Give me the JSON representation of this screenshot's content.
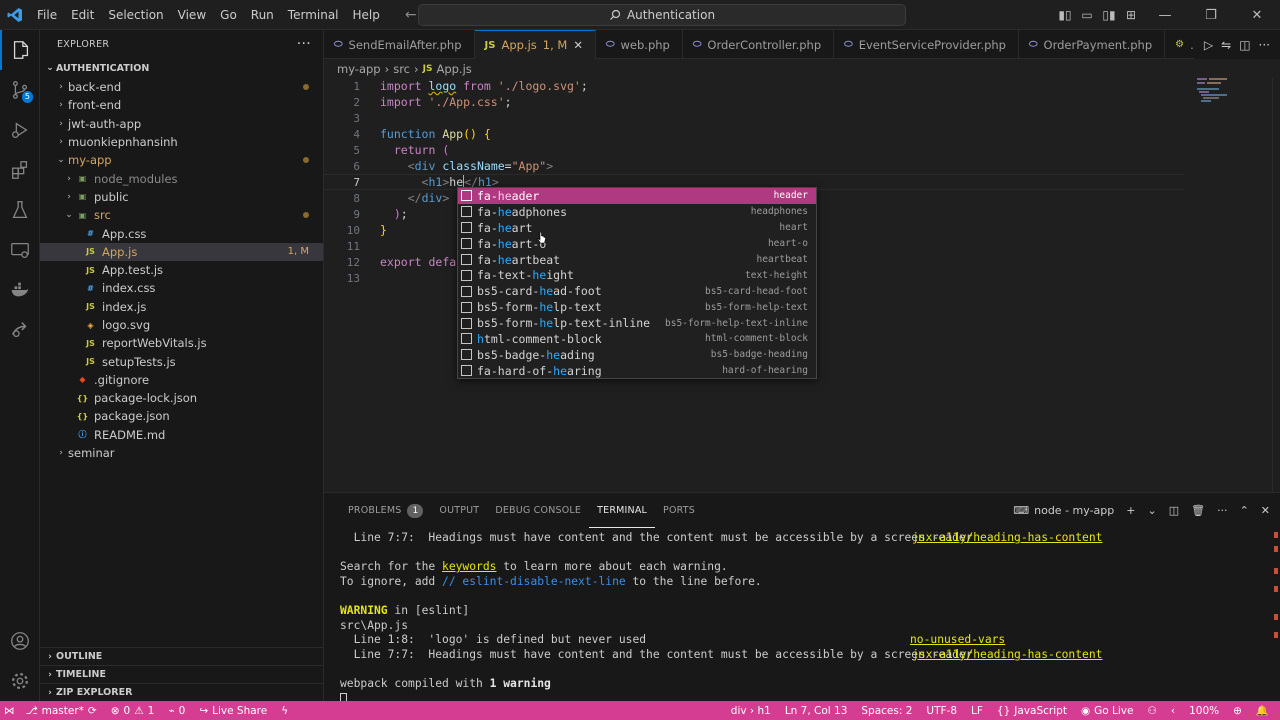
{
  "menubar": {
    "items": [
      "File",
      "Edit",
      "Selection",
      "View",
      "Go",
      "Run",
      "Terminal",
      "Help"
    ]
  },
  "search": {
    "text": "Authentication"
  },
  "sidebar": {
    "header": "EXPLORER",
    "project": "AUTHENTICATION",
    "tree": [
      {
        "label": "back-end",
        "depth": 0,
        "type": "folder",
        "open": false,
        "dot": true
      },
      {
        "label": "front-end",
        "depth": 0,
        "type": "folder",
        "open": false
      },
      {
        "label": "jwt-auth-app",
        "depth": 0,
        "type": "folder",
        "open": false
      },
      {
        "label": "muonkiepnhansinh",
        "depth": 0,
        "type": "folder",
        "open": false
      },
      {
        "label": "my-app",
        "depth": 0,
        "type": "folder",
        "open": true,
        "modified": true,
        "dot": true
      },
      {
        "label": "node_modules",
        "depth": 1,
        "type": "folder-special",
        "open": false,
        "dim": true
      },
      {
        "label": "public",
        "depth": 1,
        "type": "folder-special",
        "open": false
      },
      {
        "label": "src",
        "depth": 1,
        "type": "folder-special",
        "open": true,
        "modified": true,
        "dot": true
      },
      {
        "label": "App.css",
        "depth": 2,
        "type": "css"
      },
      {
        "label": "App.js",
        "depth": 2,
        "type": "js",
        "selected": true,
        "modified": true,
        "meta": "1, M"
      },
      {
        "label": "App.test.js",
        "depth": 2,
        "type": "js"
      },
      {
        "label": "index.css",
        "depth": 2,
        "type": "css"
      },
      {
        "label": "index.js",
        "depth": 2,
        "type": "js"
      },
      {
        "label": "logo.svg",
        "depth": 2,
        "type": "svg"
      },
      {
        "label": "reportWebVitals.js",
        "depth": 2,
        "type": "js"
      },
      {
        "label": "setupTests.js",
        "depth": 2,
        "type": "js"
      },
      {
        "label": ".gitignore",
        "depth": 1,
        "type": "git"
      },
      {
        "label": "package-lock.json",
        "depth": 1,
        "type": "json"
      },
      {
        "label": "package.json",
        "depth": 1,
        "type": "json"
      },
      {
        "label": "README.md",
        "depth": 1,
        "type": "info"
      },
      {
        "label": "seminar",
        "depth": 0,
        "type": "folder",
        "open": false
      }
    ],
    "sections": [
      "OUTLINE",
      "TIMELINE",
      "ZIP EXPLORER"
    ]
  },
  "tabs": [
    {
      "label": "SendEmailAfter.php",
      "icon": "php"
    },
    {
      "label": "App.js",
      "icon": "js",
      "active": true,
      "meta": "1, M"
    },
    {
      "label": "web.php",
      "icon": "php"
    },
    {
      "label": "OrderController.php",
      "icon": "php"
    },
    {
      "label": "EventServiceProvider.php",
      "icon": "php"
    },
    {
      "label": "OrderPayment.php",
      "icon": "php"
    },
    {
      "label": ".env",
      "icon": "env"
    }
  ],
  "breadcrumb": [
    "my-app",
    "src",
    "App.js"
  ],
  "editor": {
    "line_numbers": [
      "1",
      "2",
      "3",
      "4",
      "5",
      "6",
      "7",
      "8",
      "9",
      "10",
      "11",
      "12",
      "13"
    ],
    "current_line": 7
  },
  "suggestions": [
    {
      "prefix": "fa-",
      "match": "he",
      "rest": "ader",
      "detail": "header",
      "focused": true
    },
    {
      "prefix": "fa-",
      "match": "he",
      "rest": "adphones",
      "detail": "headphones"
    },
    {
      "prefix": "fa-",
      "match": "he",
      "rest": "art",
      "detail": "heart"
    },
    {
      "prefix": "fa-",
      "match": "he",
      "rest": "art-o",
      "detail": "heart-o"
    },
    {
      "prefix": "fa-",
      "match": "he",
      "rest": "artbeat",
      "detail": "heartbeat"
    },
    {
      "prefix": "fa-text-",
      "match": "he",
      "rest": "ight",
      "detail": "text-height"
    },
    {
      "prefix": "bs5-card-",
      "match": "he",
      "rest": "ad-foot",
      "detail": "bs5-card-head-foot"
    },
    {
      "prefix": "bs5-form-",
      "match": "he",
      "rest": "lp-text",
      "detail": "bs5-form-help-text"
    },
    {
      "prefix": "bs5-form-",
      "match": "he",
      "rest": "lp-text-inline",
      "detail": "bs5-form-help-text-inline"
    },
    {
      "prefix": "",
      "match": "h",
      "rest": "tml-comment-block",
      "detail": "html-comment-block"
    },
    {
      "prefix": "bs5-badge-",
      "match": "he",
      "rest": "ading",
      "detail": "bs5-badge-heading"
    },
    {
      "prefix": "fa-hard-of-",
      "match": "he",
      "rest": "aring",
      "detail": "hard-of-hearing"
    }
  ],
  "panel": {
    "tabs": [
      "PROBLEMS",
      "OUTPUT",
      "DEBUG CONSOLE",
      "TERMINAL",
      "PORTS"
    ],
    "problems_count": "1",
    "terminal_name": "node - my-app",
    "lines": {
      "l1_prefix": "  Line 7:7:  Headings must have content and the content must be accessible by a screen reader  ",
      "l1_rule": "jsx-a11y/heading-has-content",
      "l2_a": "Search for the ",
      "l2_kw": "keywords",
      "l2_b": " to learn more about each warning.",
      "l3_a": "To ignore, add ",
      "l3_cmt": "// eslint-disable-next-line",
      "l3_b": " to the line before.",
      "l4_warn": "WARNING",
      "l4_rest": " in [eslint]",
      "l5": "src\\App.js",
      "l6_prefix": "  Line 1:8:  'logo' is defined but never used",
      "l6_rule": "no-unused-vars",
      "l7_prefix": "  Line 7:7:  Headings must have content and the content must be accessible by a screen reader  ",
      "l7_rule": "jsx-a11y/heading-has-content",
      "l8_a": "webpack compiled with ",
      "l8_b": "1 warning"
    }
  },
  "statusbar": {
    "branch": "master*",
    "errors": "0",
    "warnings": "1",
    "ports": "0",
    "live_share": "Live Share",
    "context": "div › h1",
    "position": "Ln 7, Col 13",
    "spaces": "Spaces: 2",
    "encoding": "UTF-8",
    "eol": "LF",
    "language": "JavaScript",
    "golive": "Go Live",
    "zoom": "100%"
  },
  "colors": {
    "status_bar": "#d53d92",
    "suggest_focus": "#b03a82",
    "accent": "#0078d4"
  }
}
